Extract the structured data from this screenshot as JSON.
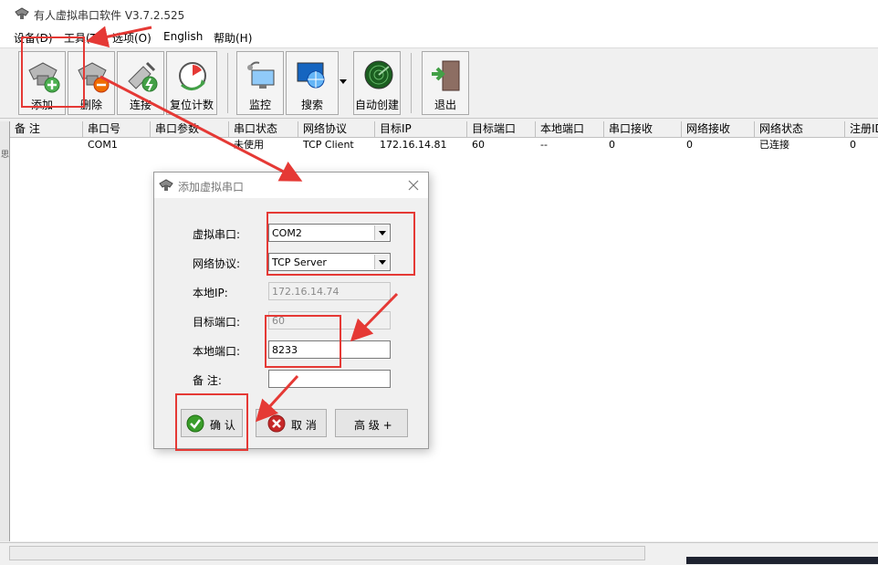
{
  "window": {
    "title": "有人虚拟串口软件 V3.7.2.525"
  },
  "menu": [
    "设备(D)",
    "工具(T)",
    "选项(O)",
    "English",
    "帮助(H)"
  ],
  "toolbar": {
    "add": "添加",
    "delete": "删除",
    "connect": "连接",
    "reset": "复位计数",
    "monitor": "监控",
    "search": "搜索",
    "autocreate": "自动创建",
    "exit": "退出"
  },
  "grid": {
    "columns": [
      "备 注",
      "串口号",
      "串口参数",
      "串口状态",
      "网络协议",
      "目标IP",
      "目标端口",
      "本地端口",
      "串口接收",
      "网络接收",
      "网络状态",
      "注册ID"
    ],
    "rows": [
      [
        "",
        "COM1",
        "",
        "未使用",
        "TCP Client",
        "172.16.14.81",
        "60",
        "--",
        "0",
        "0",
        "已连接",
        "0"
      ]
    ]
  },
  "left_strip_mark": "思",
  "dialog": {
    "title": "添加虚拟串口",
    "virtual_port_label": "虚拟串口:",
    "virtual_port_value": "COM2",
    "protocol_label": "网络协议:",
    "protocol_value": "TCP Server",
    "local_ip_label": "本地IP:",
    "local_ip_value": "172.16.14.74",
    "target_port_label": "目标端口:",
    "target_port_value": "60",
    "local_port_label": "本地端口:",
    "local_port_value": "8233",
    "remark_label": "备  注:",
    "remark_value": "",
    "ok_label": "确 认",
    "cancel_label": "取 消",
    "advanced_label": "高 级 +"
  },
  "colors": {
    "annotation": "#e53935",
    "ok_green": "#3a9d2a",
    "cancel_red": "#c62828"
  }
}
